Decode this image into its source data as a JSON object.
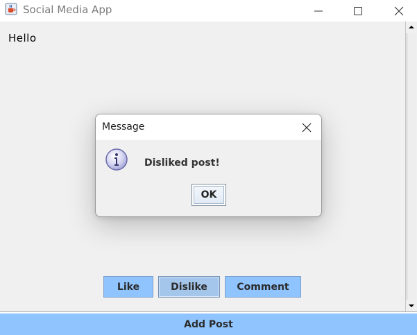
{
  "window": {
    "title": "Social Media App",
    "icon": "java-coffee-cup-icon"
  },
  "post": {
    "text": "Hello"
  },
  "actions": {
    "like_label": "Like",
    "dislike_label": "Dislike",
    "comment_label": "Comment"
  },
  "footer": {
    "add_post_label": "Add Post"
  },
  "dialog": {
    "title": "Message",
    "message": "Disliked post!",
    "ok_label": "OK",
    "icon": "information-icon"
  },
  "colors": {
    "button_blue": "#8fc4ff",
    "background": "#f0f0f0"
  }
}
